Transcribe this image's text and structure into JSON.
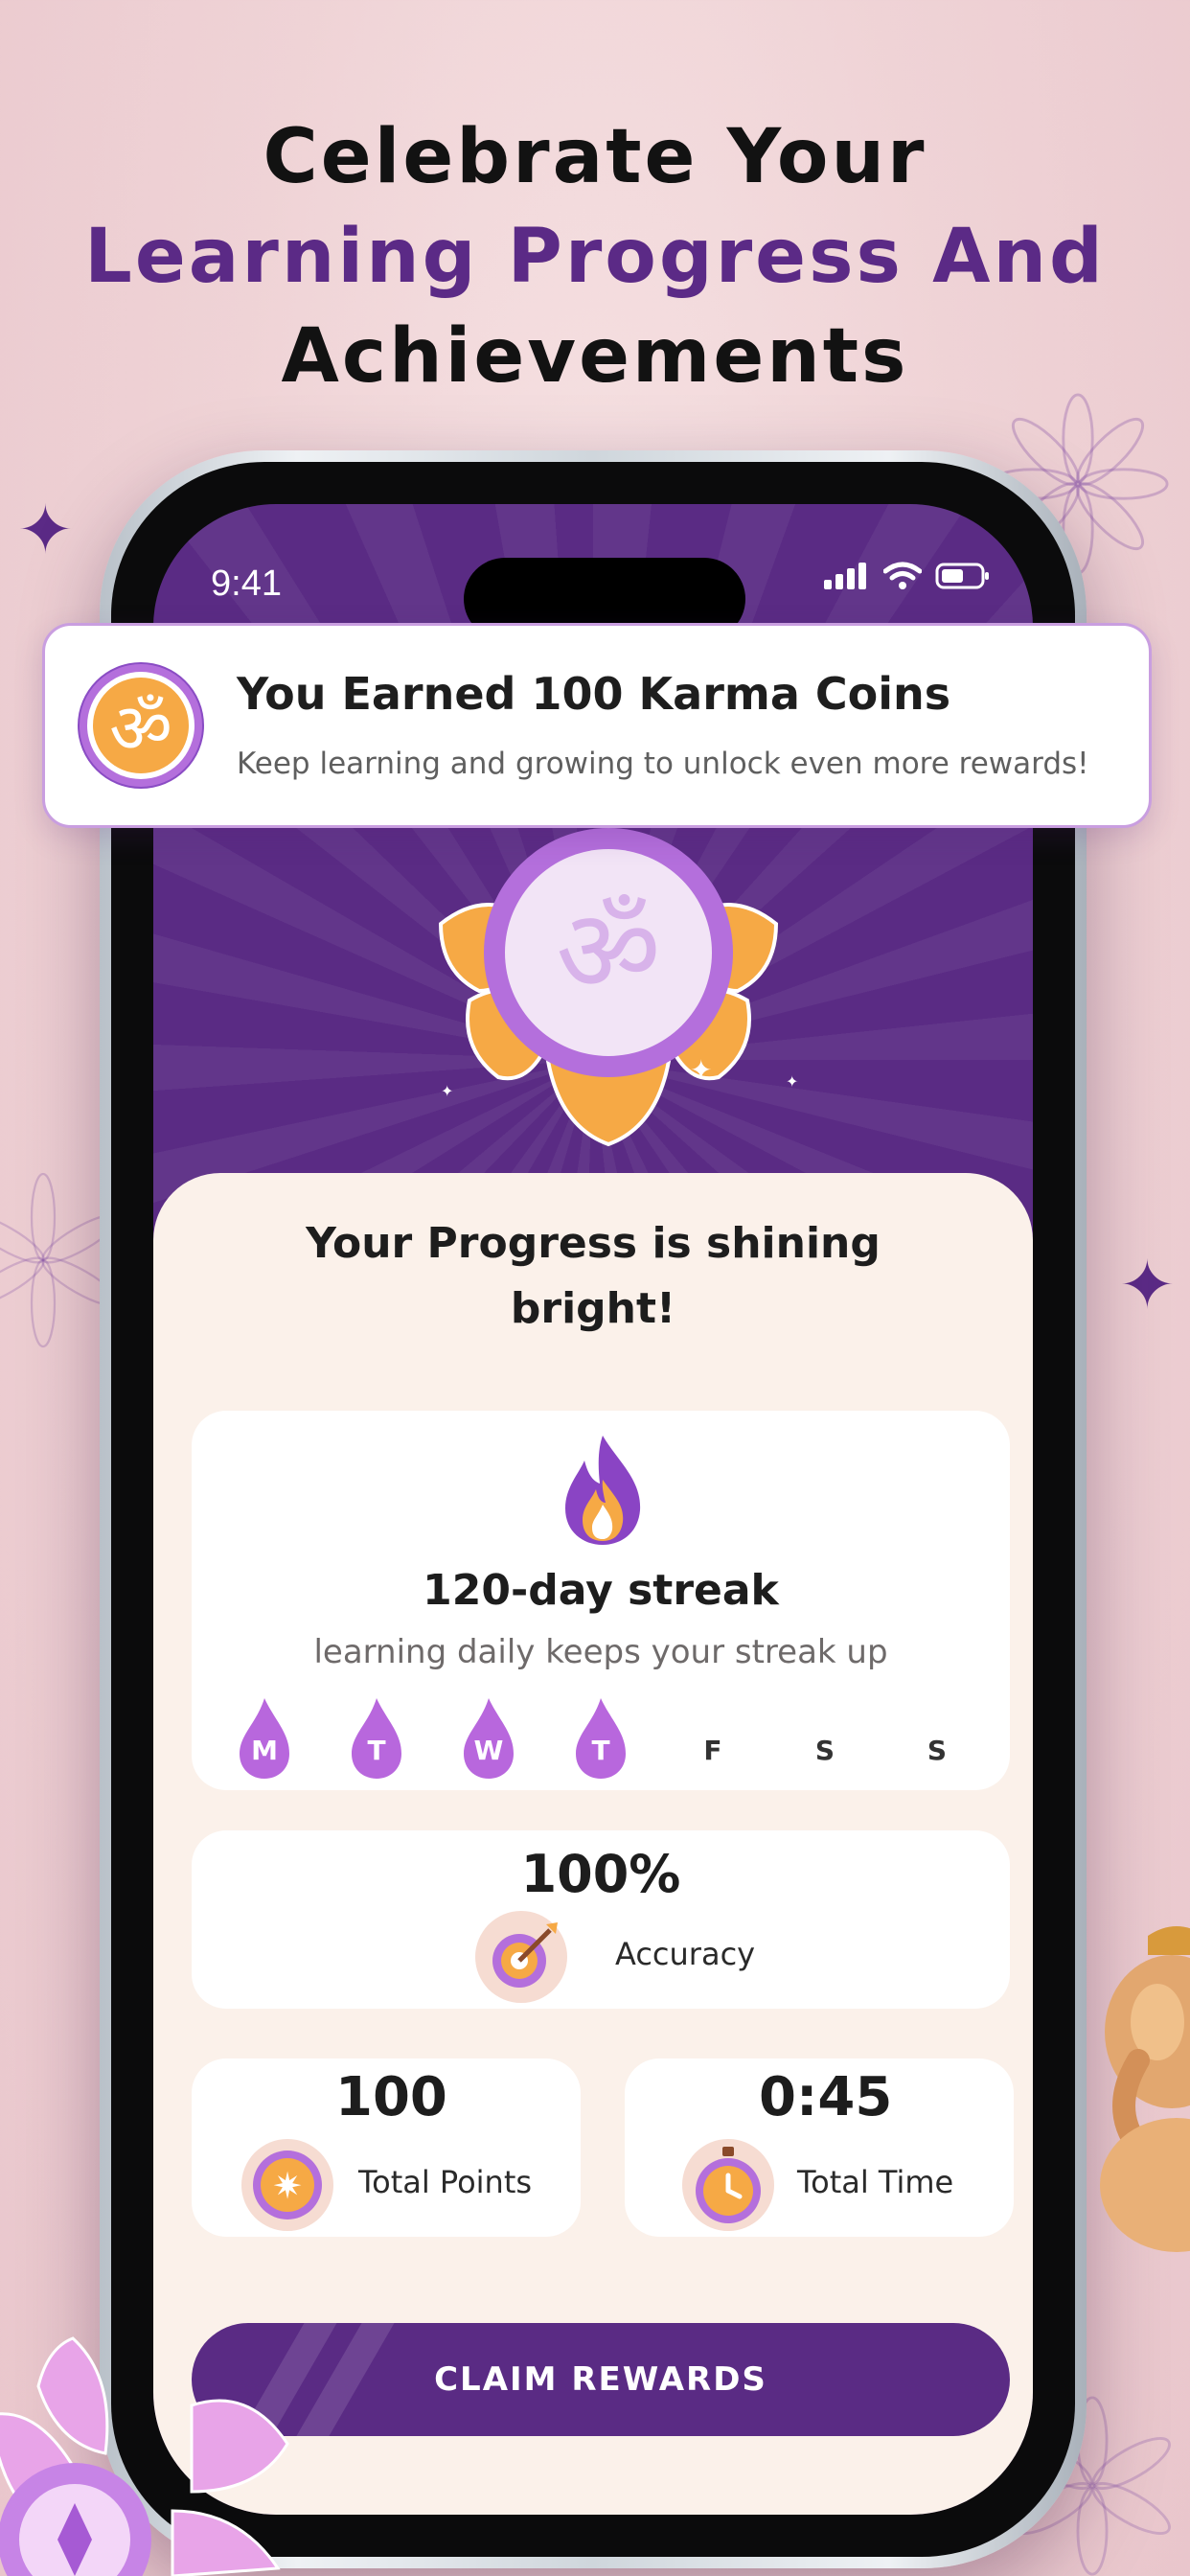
{
  "headline": {
    "line1": "Celebrate Your",
    "line2": "Learning Progress And",
    "line3": "Achievements"
  },
  "status_bar": {
    "time": "9:41"
  },
  "notification": {
    "title": "You Earned 100 Karma Coins",
    "subtitle": "Keep learning and growing to unlock even more rewards!",
    "icon": "om-coin-icon"
  },
  "progress": {
    "title_line1": "Your Progress is shining",
    "title_line2": "bright!"
  },
  "streak": {
    "title": "120-day streak",
    "subtitle": "learning daily keeps your streak up",
    "days": [
      {
        "label": "M",
        "active": true
      },
      {
        "label": "T",
        "active": true
      },
      {
        "label": "W",
        "active": true
      },
      {
        "label": "T",
        "active": true
      },
      {
        "label": "F",
        "active": false
      },
      {
        "label": "S",
        "active": false
      },
      {
        "label": "S",
        "active": false
      }
    ]
  },
  "accuracy": {
    "value": "100%",
    "label": "Accuracy"
  },
  "points": {
    "value": "100",
    "label": "Total Points"
  },
  "total_time": {
    "value": "0:45",
    "label": "Total Time"
  },
  "claim_button": {
    "label": "CLAIM REWARDS"
  },
  "colors": {
    "brand_purple": "#5a2b84",
    "accent_orange": "#f5a64a",
    "light_purple": "#b46fdc"
  }
}
